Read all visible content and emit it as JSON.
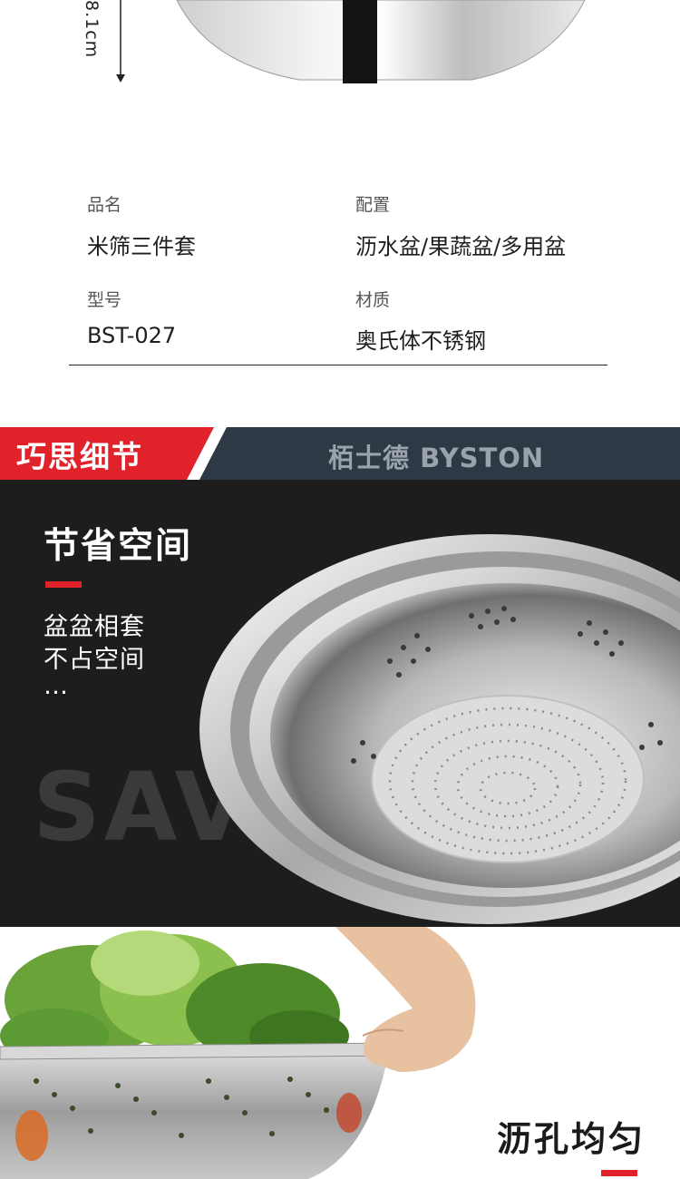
{
  "dimension_label": "8.1cm",
  "specs": [
    {
      "key": "品名",
      "value": "米筛三件套"
    },
    {
      "key": "配置",
      "value": "沥水盆/果蔬盆/多用盆"
    },
    {
      "key": "型号",
      "value": "BST-027"
    },
    {
      "key": "材质",
      "value": "奥氏体不锈钢"
    }
  ],
  "banner": {
    "title": "巧思细节",
    "brand": "栢士德 BYSTON",
    "colors": {
      "red": "#e1222b",
      "navy": "#2d3945"
    }
  },
  "feature_space": {
    "title": "节省空间",
    "lines": [
      "盆盆相套",
      "不占空间",
      "…"
    ],
    "background_word": "SAVE"
  },
  "feature_holes": {
    "title": "沥孔均匀"
  }
}
